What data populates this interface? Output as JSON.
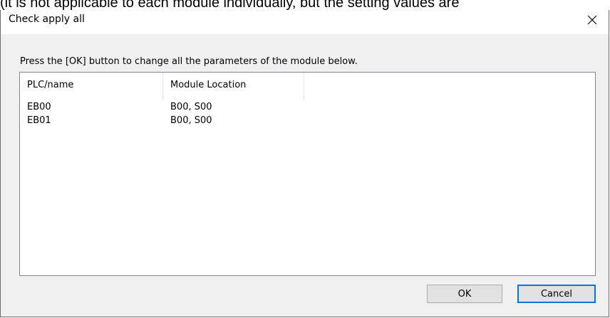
{
  "background_text": "(it is not applicable to each module individually, but the setting values are",
  "dialog": {
    "title": "Check apply all",
    "close_icon": "close-icon",
    "instruction": "Press the [OK] button to change all the parameters of the module below.",
    "columns": [
      "PLC/name",
      "Module Location"
    ],
    "rows": [
      {
        "name": "EB00",
        "location": "B00, S00"
      },
      {
        "name": "EB01",
        "location": "B00, S00"
      }
    ],
    "ok_label": "OK",
    "cancel_label": "Cancel"
  },
  "colors": {
    "dialog_background": "#f0f0f0",
    "focus_border": "#0078d7"
  }
}
